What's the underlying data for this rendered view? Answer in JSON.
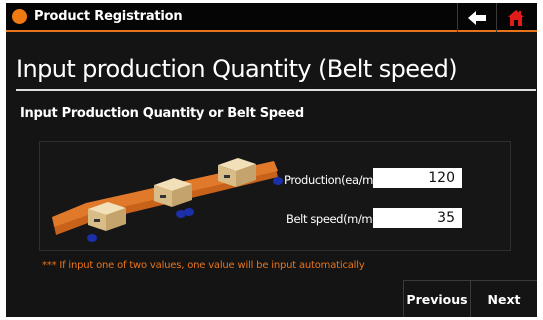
{
  "header": {
    "title": "Product Registration",
    "back_icon": "arrow-left-icon",
    "home_icon": "home-icon",
    "accent": "#e8741c",
    "home_color": "#e21b1b"
  },
  "main": {
    "heading": "Input production Quantity (Belt speed)",
    "subtitle": "Input Production Quantity or Belt Speed",
    "fields": [
      {
        "label": "Production(ea/min)",
        "value": "120"
      },
      {
        "label": "Belt speed(m/min)",
        "value": "35"
      }
    ],
    "note": "*** If input one of two values, one value will be input automatically"
  },
  "nav": {
    "previous_label": "Previous",
    "next_label": "Next"
  }
}
